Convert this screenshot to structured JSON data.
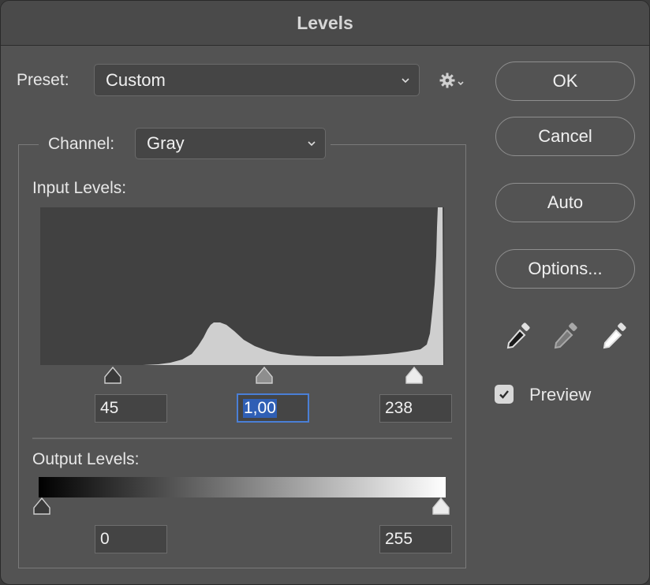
{
  "window": {
    "title": "Levels"
  },
  "preset": {
    "label": "Preset:",
    "value": "Custom"
  },
  "channel": {
    "label": "Channel:",
    "value": "Gray"
  },
  "input_levels": {
    "label": "Input Levels:",
    "black": "45",
    "gamma": "1,00",
    "white": "238"
  },
  "output_levels": {
    "label": "Output Levels:",
    "black": "0",
    "white": "255"
  },
  "buttons": {
    "ok": "OK",
    "cancel": "Cancel",
    "auto": "Auto",
    "options": "Options..."
  },
  "preview": {
    "label": "Preview",
    "checked": true
  },
  "icons": {
    "preset_settings": "gear-icon",
    "eyedroppers": [
      "black-point-eyedropper-icon",
      "gray-point-eyedropper-icon",
      "white-point-eyedropper-icon"
    ]
  },
  "colors": {
    "dialog_bg": "#535353",
    "histogram_bg": "#414141",
    "histogram_fill": "#cfcfcf",
    "focus_accent": "#4a7fd6"
  }
}
